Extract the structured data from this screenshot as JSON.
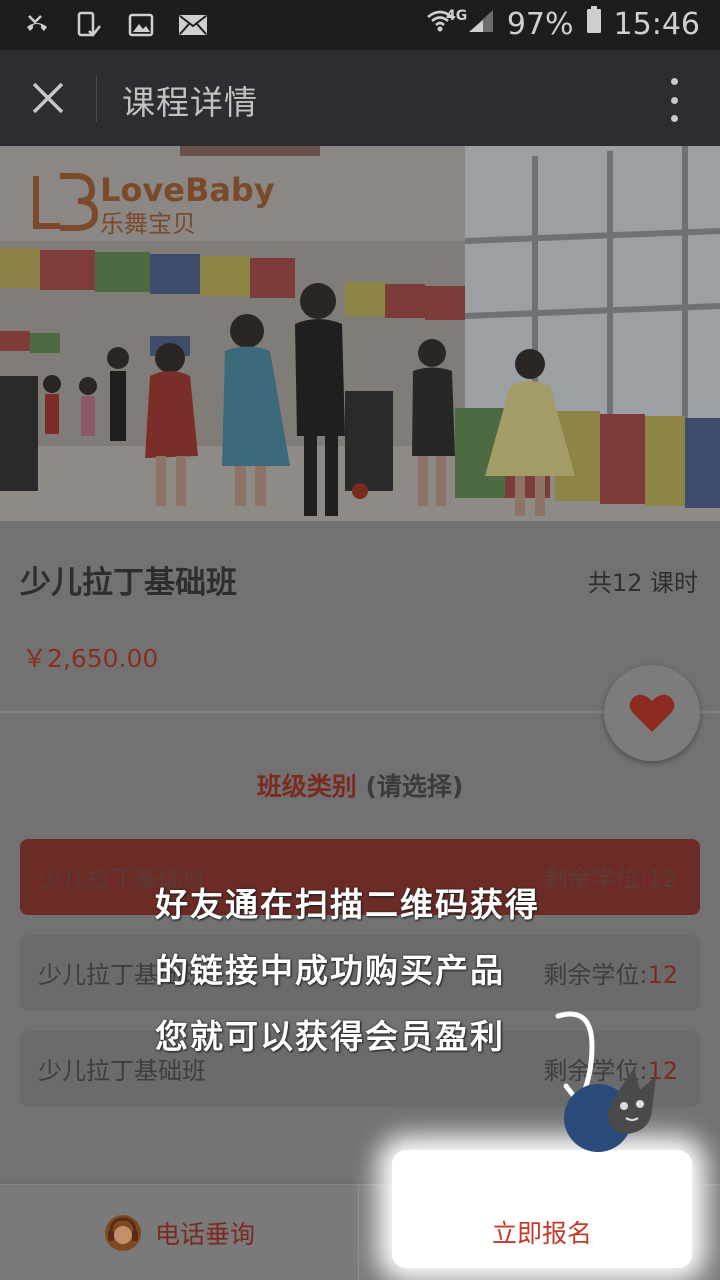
{
  "status_bar": {
    "network_type": "4G",
    "battery_percent": "97%",
    "time": "15:46"
  },
  "nav": {
    "title": "课程详情"
  },
  "hero": {
    "logo_brand": "LoveBaby",
    "logo_subtitle": "乐舞宝贝"
  },
  "course": {
    "name": "少儿拉丁基础班",
    "lesson_count": "共12 课时",
    "price": "￥2,650.00"
  },
  "class_selection": {
    "title": "班级类别",
    "subtitle": "(请选择)",
    "options": [
      {
        "label": "少儿拉丁基础班",
        "seats_label": "剩余学位:",
        "seats": "12",
        "selected": true
      },
      {
        "label": "少儿拉丁基础班",
        "seats_label": "剩余学位:",
        "seats": "12",
        "selected": false
      },
      {
        "label": "少儿拉丁基础班",
        "seats_label": "剩余学位:",
        "seats": "12",
        "selected": false
      }
    ]
  },
  "bottom_bar": {
    "phone_label": "电话垂询",
    "register_label": "立即报名"
  },
  "annotation": {
    "line1": "好友通在扫描二维码获得",
    "line2": "的链接中成功购买产品",
    "line3": "您就可以获得会员盈利"
  },
  "colors": {
    "accent_red": "#c6392a",
    "nav_background": "#2c2d30",
    "status_background": "#1c1d1f"
  }
}
